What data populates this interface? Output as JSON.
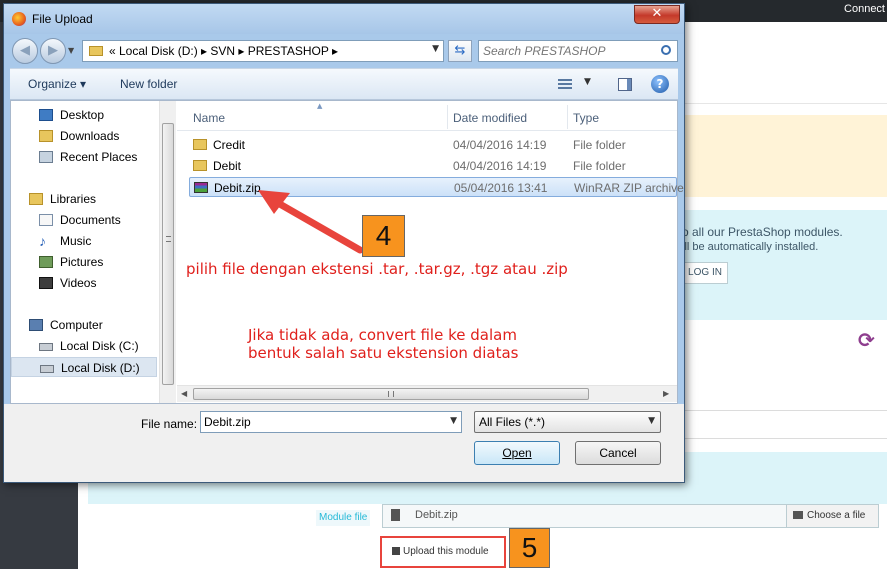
{
  "background": {
    "connect_label": "Connect",
    "banner_text": "o all our PrestaShop modules.",
    "banner_sub": "ill be automatically installed.",
    "login_label": "LOG IN",
    "module_file_label": "Module file",
    "module_file_value": "Debit.zip",
    "choose_file_label": "Choose a file",
    "upload_label": "Upload this module"
  },
  "dialog": {
    "title": "File Upload",
    "close_glyph": "✕",
    "address_path": "«  Local Disk (D:)  ▸  SVN  ▸  PRESTASHOP  ▸",
    "search_placeholder": "Search PRESTASHOP",
    "toolbar": {
      "organize_label": "Organize ▾",
      "new_folder_label": "New folder"
    },
    "nav_items": [
      {
        "label": "Desktop",
        "icon": "desktop-icon",
        "indent": 1,
        "selected": false
      },
      {
        "label": "Downloads",
        "icon": "downloads-icon",
        "indent": 1,
        "selected": false
      },
      {
        "label": "Recent Places",
        "icon": "recent-places-icon",
        "indent": 1,
        "selected": false
      },
      {
        "label": "Libraries",
        "icon": "libraries-icon",
        "indent": 0,
        "selected": false
      },
      {
        "label": "Documents",
        "icon": "documents-icon",
        "indent": 1,
        "selected": false
      },
      {
        "label": "Music",
        "icon": "music-icon",
        "indent": 1,
        "selected": false
      },
      {
        "label": "Pictures",
        "icon": "pictures-icon",
        "indent": 1,
        "selected": false
      },
      {
        "label": "Videos",
        "icon": "videos-icon",
        "indent": 1,
        "selected": false
      },
      {
        "label": "Computer",
        "icon": "computer-icon",
        "indent": 0,
        "selected": false
      },
      {
        "label": "Local Disk (C:)",
        "icon": "disk-icon",
        "indent": 1,
        "selected": false
      },
      {
        "label": "Local Disk (D:)",
        "icon": "disk-icon",
        "indent": 1,
        "selected": true
      }
    ],
    "columns": {
      "name": "Name",
      "date": "Date modified",
      "type": "Type"
    },
    "files": [
      {
        "name": "Credit",
        "date": "04/04/2016 14:19",
        "type": "File folder",
        "icon": "folder-icon",
        "selected": false
      },
      {
        "name": "Debit",
        "date": "04/04/2016 14:19",
        "type": "File folder",
        "icon": "folder-icon",
        "selected": false
      },
      {
        "name": "Debit.zip",
        "date": "05/04/2016 13:41",
        "type": "WinRAR ZIP archive",
        "icon": "zip-icon",
        "selected": true
      }
    ],
    "file_name_label": "File name:",
    "file_name_value": "Debit.zip",
    "file_type_value": "All Files (*.*)",
    "open_label": "Open",
    "cancel_label": "Cancel"
  },
  "annotations": {
    "badge4": "4",
    "badge5": "5",
    "note_extensions": "pilih file dengan ekstensi .tar, .tar.gz, .tgz atau .zip",
    "note_convert_line1": "Jika tidak ada, convert file ke dalam",
    "note_convert_line2": "bentuk salah satu ekstension diatas",
    "accent_color": "#e0201c",
    "badge_color": "#f7931e"
  }
}
